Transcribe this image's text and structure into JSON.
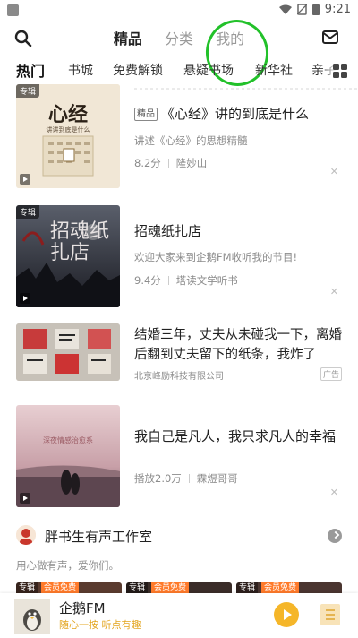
{
  "status_bar": {
    "time": "9:21"
  },
  "header": {
    "tabs": [
      {
        "label": "精品",
        "active": true
      },
      {
        "label": "分类",
        "active": false
      },
      {
        "label": "我的",
        "active": false
      }
    ]
  },
  "categories": {
    "items": [
      "热门",
      "书城",
      "免费解锁",
      "悬疑书场",
      "新华社",
      "亲子"
    ],
    "active_index": 0
  },
  "feed": [
    {
      "badge": "专辑",
      "tag": "精品",
      "title": "《心经》讲的到底是什么",
      "desc": "讲述《心经》的思想精髓",
      "score": "8.2分",
      "author": "隆妙山",
      "cover_title": "心经",
      "cover_sub": "讲讲到底是什么"
    },
    {
      "badge": "专辑",
      "title": "招魂纸扎店",
      "desc": "欢迎大家来到企鹅FM收听我的节目!",
      "score": "9.4分",
      "author": "塔读文学听书",
      "cover_title": "招魂纸扎店"
    },
    {
      "title": "结婚三年，丈夫从未碰我一下，离婚后翻到丈夫留下的纸条，我炸了",
      "advertiser": "北京峰励科技有限公司",
      "ad_label": "广告"
    },
    {
      "badge": "专辑",
      "title": "我自己是凡人，我只求凡人的幸福",
      "plays": "播放2.0万",
      "author": "霖煜哥哥",
      "cover_text": "深夜情感治愈系"
    }
  ],
  "studio": {
    "name": "胖书生有声工作室",
    "desc": "用心做有声，爱你们。",
    "strip_tags": [
      "专辑",
      "会员免费",
      "专辑",
      "会员免费",
      "专辑",
      "会员免费"
    ]
  },
  "player": {
    "name": "企鹅FM",
    "subtitle": "随心一按 听点有趣"
  },
  "colors": {
    "accent": "#f5b629",
    "annotation": "#22c12a"
  }
}
